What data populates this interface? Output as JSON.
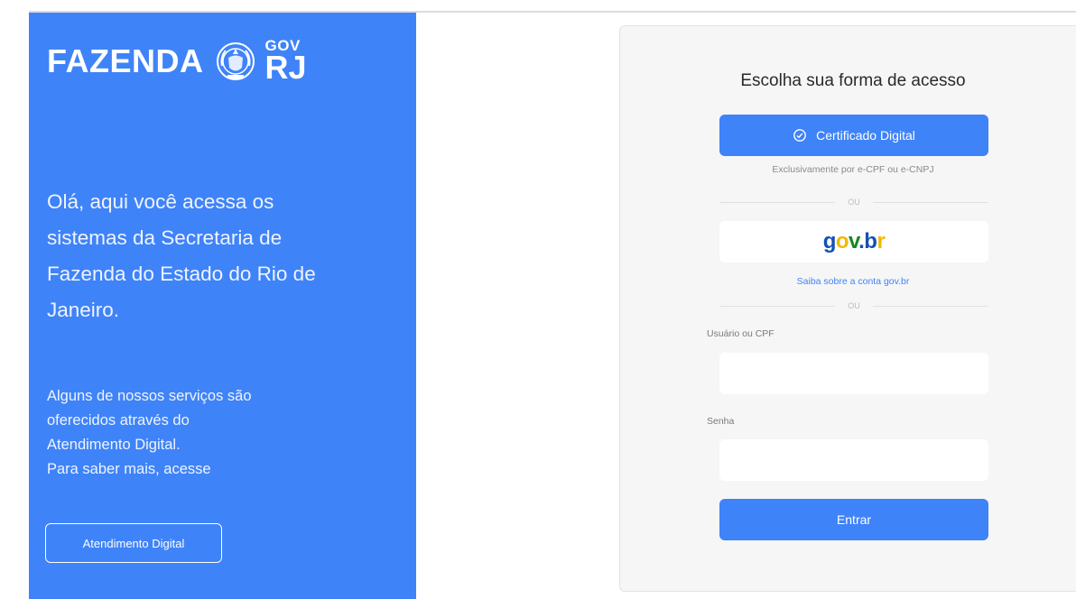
{
  "brand": {
    "name": "FAZENDA",
    "gov": "GOV",
    "rj": "RJ"
  },
  "left": {
    "intro": "Olá, aqui você acessa os sistemas da Secretaria de Fazenda do Estado do Rio de Janeiro.",
    "services": [
      "Alguns de nossos serviços são",
      "oferecidos através do",
      "Atendimento Digital.",
      "Para saber mais, acesse"
    ],
    "atendimento_button": "Atendimento Digital"
  },
  "login": {
    "title": "Escolha sua forma de acesso",
    "certificado_button": "Certificado Digital",
    "certificado_note": "Exclusivamente por e-CPF ou e-CNPJ",
    "divider": "OU",
    "govbr_link": "Saiba sobre a conta gov.br",
    "user_label": "Usuário ou CPF",
    "user_value": "",
    "password_label": "Senha",
    "password_value": "",
    "submit_button": "Entrar"
  },
  "colors": {
    "primary_blue": "#3f83f8",
    "card_bg": "#f6f6f6"
  },
  "icons": [
    "brasao-rj-seal-icon",
    "certificate-icon",
    "govbr-logo"
  ]
}
